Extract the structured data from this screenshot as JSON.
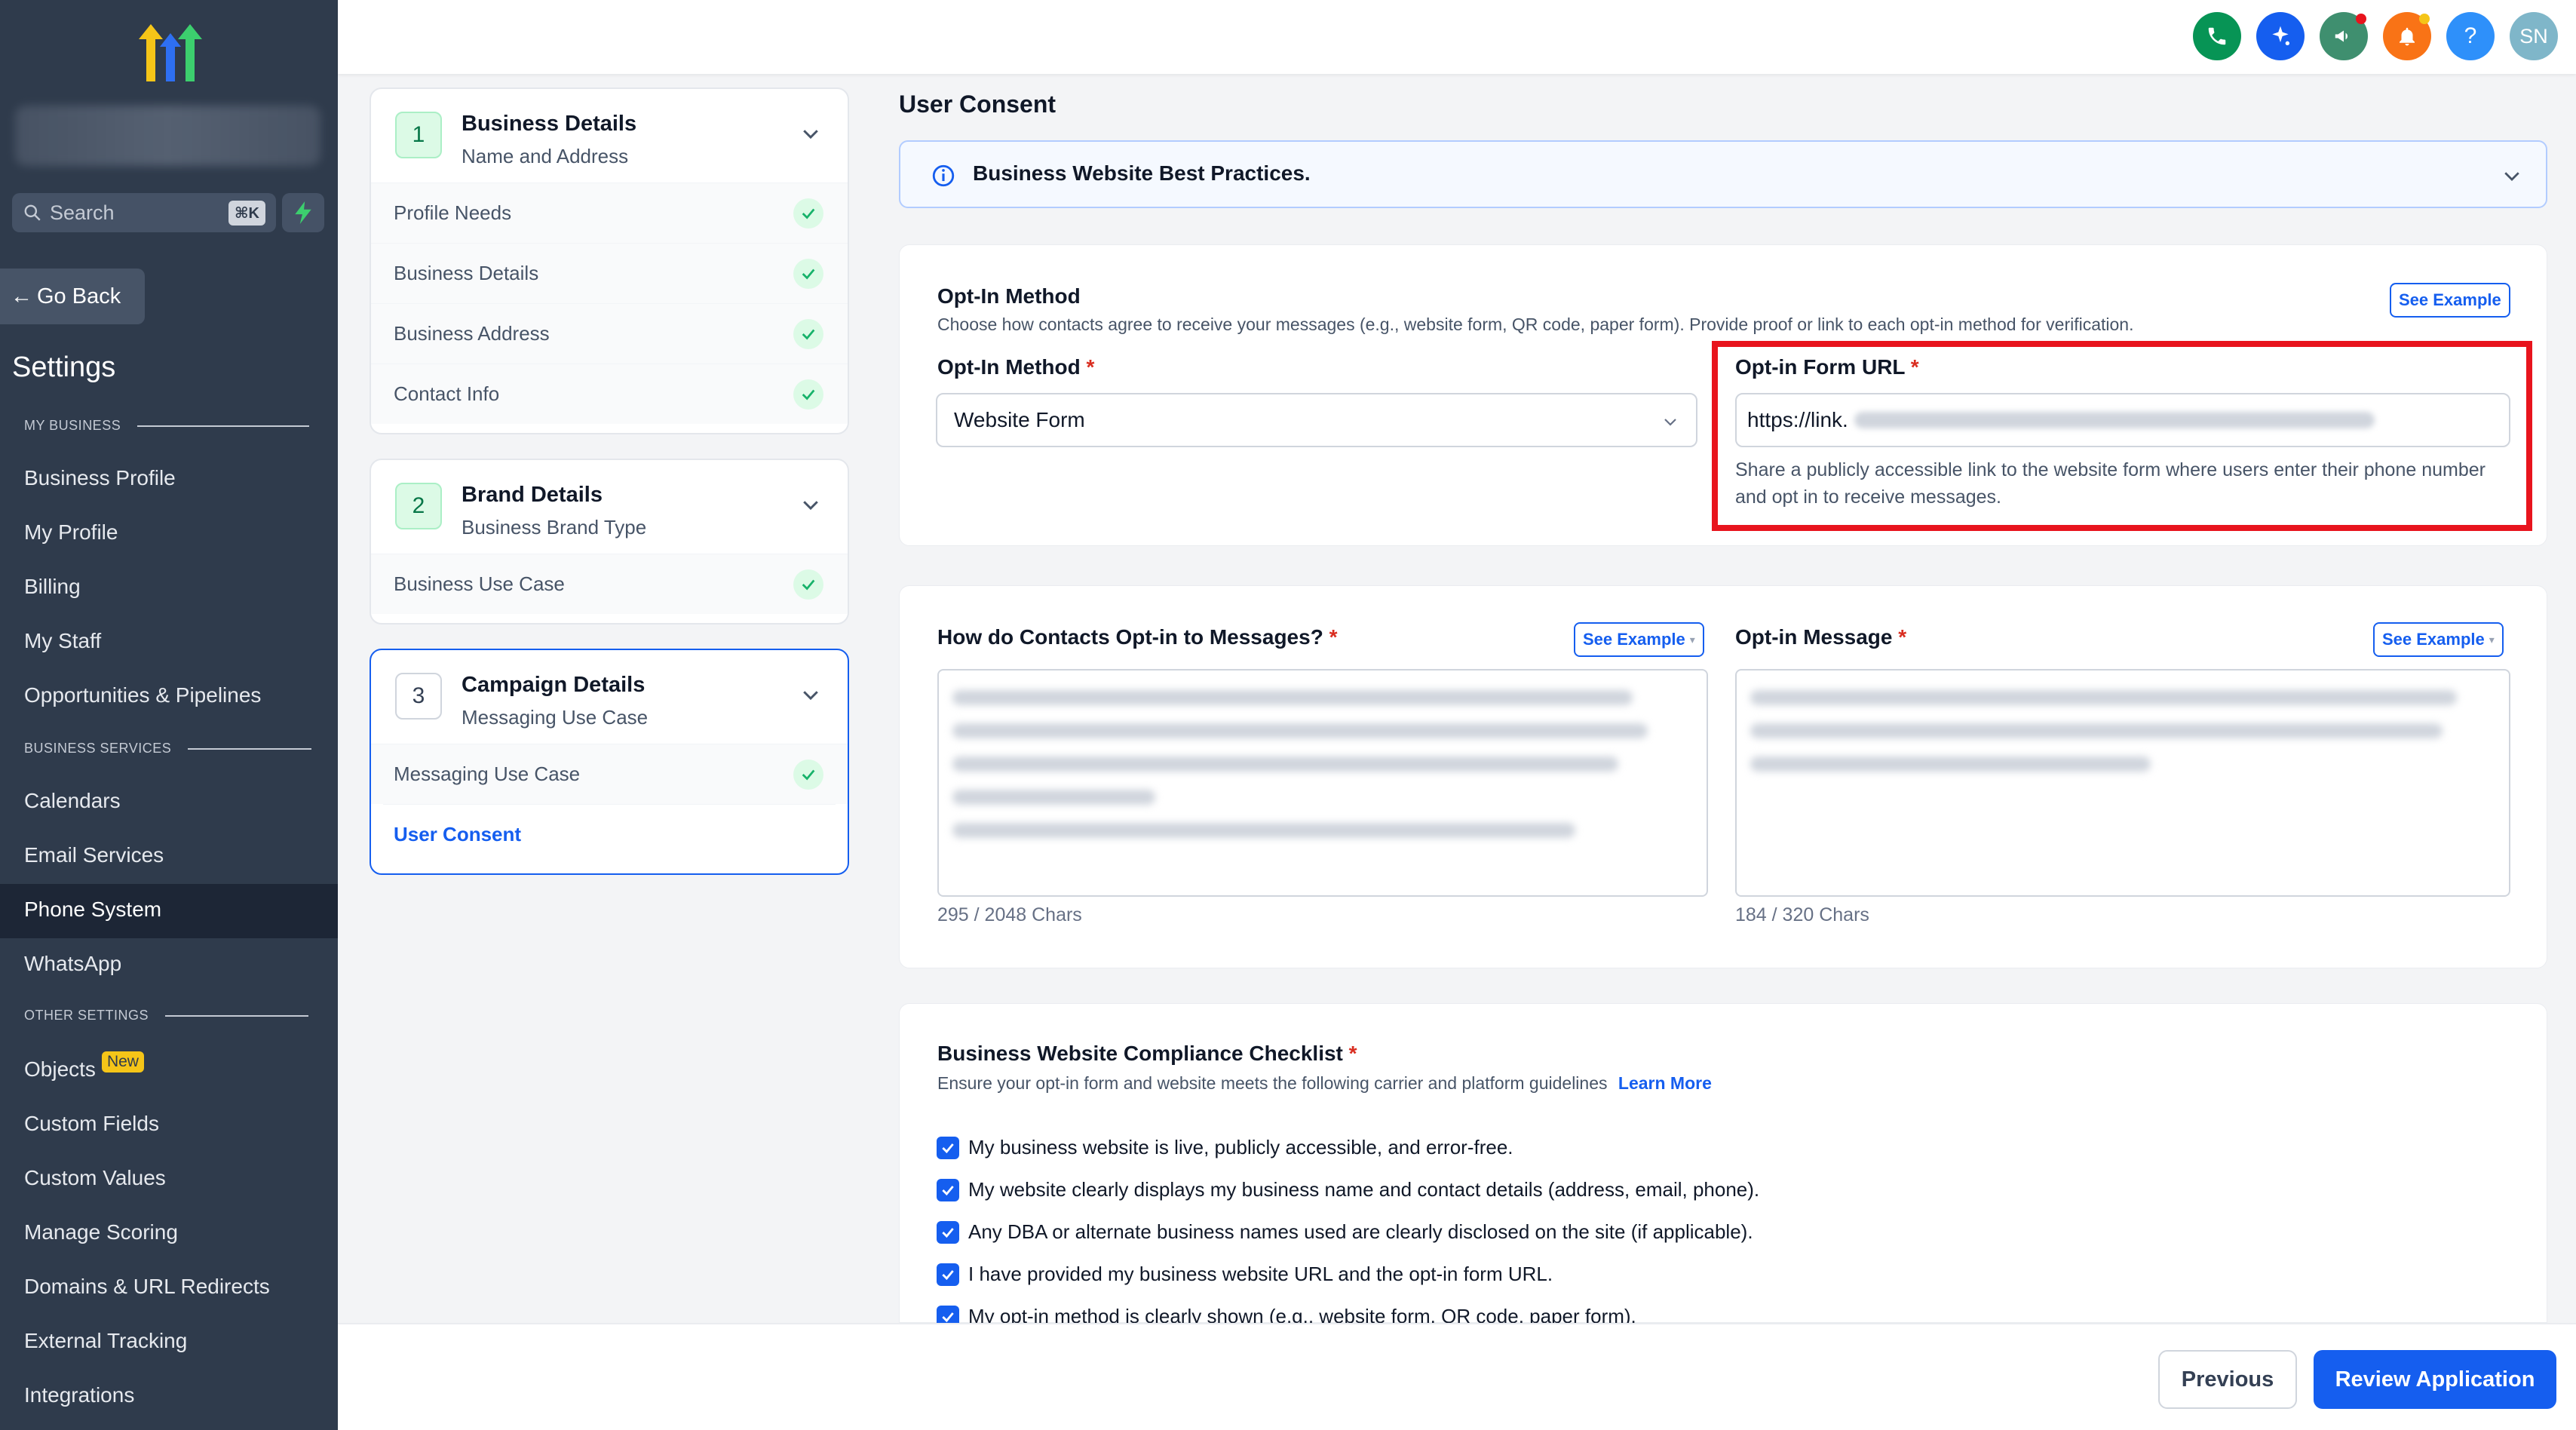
{
  "sidebar": {
    "search_placeholder": "Search",
    "search_shortcut": "⌘K",
    "go_back": "Go Back",
    "settings_title": "Settings",
    "sections": {
      "my_business": "MY BUSINESS",
      "business_services": "BUSINESS SERVICES",
      "other_settings": "OTHER SETTINGS"
    },
    "items": [
      "Business Profile",
      "My Profile",
      "Billing",
      "My Staff",
      "Opportunities & Pipelines",
      "Calendars",
      "Email Services",
      "Phone System",
      "WhatsApp",
      "Objects",
      "Custom Fields",
      "Custom Values",
      "Manage Scoring",
      "Domains & URL Redirects",
      "External Tracking",
      "Integrations"
    ],
    "objects_badge": "New",
    "active_item": "Phone System",
    "colors": {
      "bg": "#2f3b4c",
      "active": "#1d2636",
      "badge": "#f5c518"
    }
  },
  "topbar": {
    "icons": [
      "phone-icon",
      "sparkle-icon",
      "megaphone-icon",
      "bell-icon",
      "help-icon"
    ],
    "help_glyph": "?",
    "avatar_initials": "SN",
    "colors": {
      "phone": "#079455",
      "sparkle": "#155eef",
      "megaphone": "#3f8f6f",
      "bell": "#f97316",
      "help": "#2e90fa",
      "avatar": "#7fb6c9"
    }
  },
  "steps": [
    {
      "number": "1",
      "title": "Business Details",
      "subtitle": "Name and Address",
      "substeps": [
        "Profile Needs",
        "Business Details",
        "Business Address",
        "Contact Info"
      ]
    },
    {
      "number": "2",
      "title": "Brand Details",
      "subtitle": "Business Brand Type",
      "substeps": [
        "Business Use Case"
      ]
    },
    {
      "number": "3",
      "title": "Campaign Details",
      "subtitle": "Messaging Use Case",
      "substeps": [
        "Messaging Use Case",
        "User Consent"
      ]
    }
  ],
  "main": {
    "title": "User Consent",
    "info_banner": "Business Website Best Practices.",
    "opt_in": {
      "section_title": "Opt-In Method",
      "section_desc": "Choose how contacts agree to receive your messages (e.g., website form, QR code, paper form). Provide proof or link to each opt-in method for verification.",
      "see_example": "See Example",
      "method_label": "Opt-In Method",
      "required_mark": "*",
      "method_value": "Website Form",
      "url_label": "Opt-in Form URL",
      "url_value": "https://link.",
      "url_help": "Share a publicly accessible link to the website form where users enter their phone number and opt in to receive messages."
    },
    "messages": {
      "how_label": "How do Contacts Opt-in to Messages?",
      "how_see_example": "See Example",
      "how_counter": "295 / 2048 Chars",
      "msg_label": "Opt-in Message",
      "msg_see_example": "See Example",
      "msg_counter": "184 / 320 Chars"
    },
    "checklist": {
      "title": "Business Website Compliance Checklist",
      "desc": "Ensure your opt-in form and website meets the following carrier and platform guidelines",
      "learn_more": "Learn More",
      "items": [
        "My business website is live, publicly accessible, and error-free.",
        "My website clearly displays my business name and contact details (address, email, phone).",
        "Any DBA or alternate business names used are clearly disclosed on the site (if applicable).",
        "I have provided my business website URL and the opt-in form URL.",
        "My opt-in method is clearly shown (e.g., website form, QR code, paper form)."
      ]
    }
  },
  "footer": {
    "previous": "Previous",
    "review": "Review Application"
  },
  "colors": {
    "primary": "#155eef",
    "success": "#17b26a",
    "highlight": "#e8141d"
  }
}
